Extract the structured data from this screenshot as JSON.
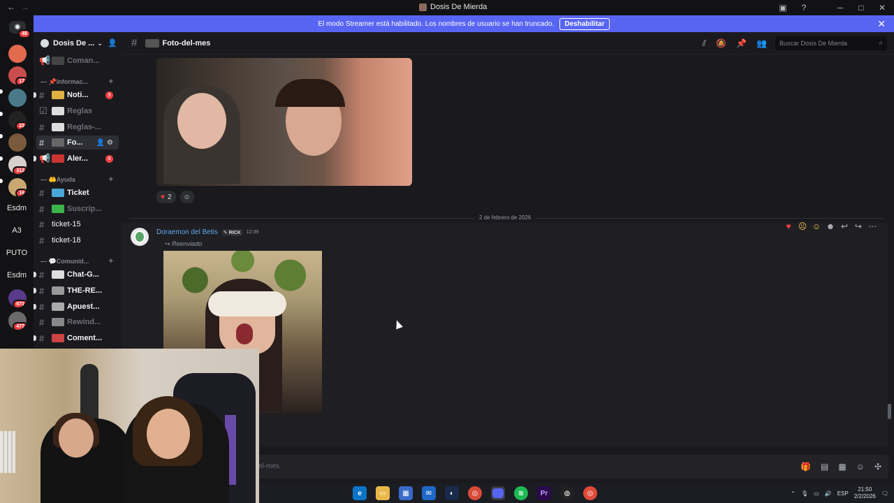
{
  "titlebar": {
    "title": "Dosis De Mierda",
    "back": "←",
    "forward": "→"
  },
  "banner": {
    "text": "El modo Streamer está habilitado. Los nombres de usuario se han truncado.",
    "button": "Deshabilitar"
  },
  "rail": {
    "badges": [
      "48",
      "17",
      "23",
      "313",
      "16",
      "671",
      "477"
    ],
    "text_servers": [
      "Esdm",
      "A3",
      "PUTO",
      "Esdm"
    ]
  },
  "server": {
    "name": "Dosis De ..."
  },
  "channels": {
    "top": {
      "name": "Coman..."
    },
    "cat_info": "Informac...",
    "items_info": [
      {
        "name": "Noti...",
        "badge": "9"
      },
      {
        "name": "Reglas"
      },
      {
        "name": "Reglas-..."
      },
      {
        "name": "Fo..."
      },
      {
        "name": "Aler...",
        "badge": "8"
      }
    ],
    "cat_ayuda": "Ayuda",
    "items_ayuda": [
      {
        "name": "Ticket"
      },
      {
        "name": "Suscrip..."
      },
      {
        "name": "ticket-15"
      },
      {
        "name": "ticket-18"
      }
    ],
    "cat_comunidad": "Comunid...",
    "items_comunidad": [
      {
        "name": "Chat-G..."
      },
      {
        "name": "THE-RE..."
      },
      {
        "name": "Apuest..."
      },
      {
        "name": "Rewind..."
      },
      {
        "name": "Coment..."
      }
    ]
  },
  "channel_header": {
    "name": "Foto-del-mes",
    "search_placeholder": "Buscar Dosis De Mierda"
  },
  "message1": {
    "reaction_count": "2"
  },
  "date_divider": "2 de febrero de 2026",
  "message2": {
    "author": "Doraemon del Betis",
    "tag": "RICK",
    "time": "12:39",
    "forwarded": "Reenviado"
  },
  "composer": {
    "placeholder": "el-mes"
  },
  "taskbar": {
    "lang": "ESP",
    "time": "21:50",
    "date": "2/2/2026"
  },
  "colors": {
    "accent": "#5865f2",
    "author": "#5fa8e8",
    "badge": "#f23f43"
  }
}
